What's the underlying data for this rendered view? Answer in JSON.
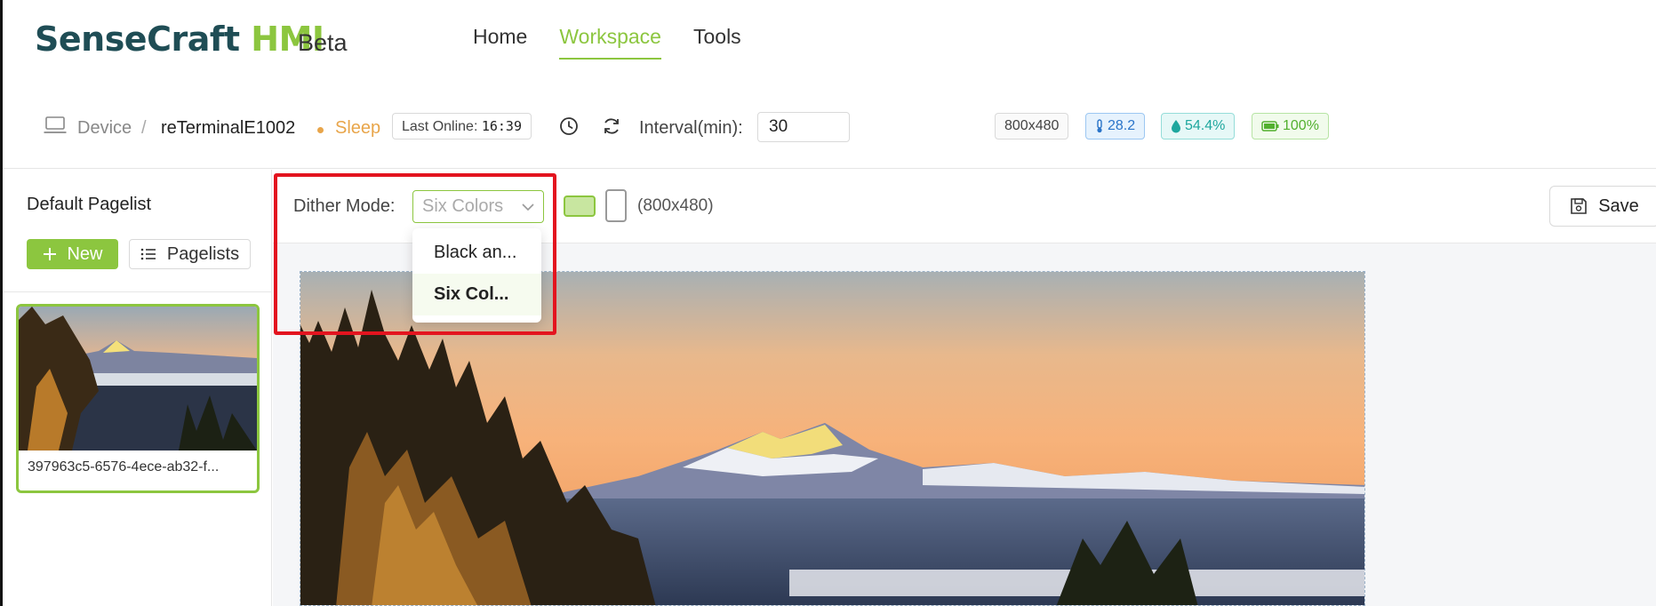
{
  "brand": {
    "name_part1": "SenseCraft",
    "name_part2": "HMI",
    "tag": "Beta"
  },
  "nav": {
    "items": [
      {
        "label": "Home",
        "active": false
      },
      {
        "label": "Workspace",
        "active": true
      },
      {
        "label": "Tools",
        "active": false
      }
    ]
  },
  "device": {
    "breadcrumb_root": "Device",
    "breadcrumb_sep": "/",
    "name": "reTerminalE1002",
    "status": "Sleep",
    "last_online_label": "Last Online:",
    "last_online_time": "16:39",
    "interval_label": "Interval(min):",
    "interval_value": "30",
    "resolution": "800x480",
    "temperature": "28.2",
    "humidity": "54.4%",
    "battery": "100%"
  },
  "sidebar": {
    "title": "Default Pagelist",
    "new_label": "New",
    "pagelists_label": "Pagelists",
    "page_card_name": "397963c5-6576-4ece-ab32-f..."
  },
  "toolbar": {
    "dither_label": "Dither Mode:",
    "dither_selected": "Six Colors",
    "resolution_text": "(800x480)",
    "save_label": "Save"
  },
  "dropdown": {
    "options": [
      {
        "label": "Black an...",
        "selected": false
      },
      {
        "label": "Six Col...",
        "selected": true
      }
    ]
  },
  "colors": {
    "accent": "#8cc63f",
    "brand_dark": "#1f4d55",
    "status_sleep": "#e8a54a",
    "highlight": "#e3141f"
  }
}
